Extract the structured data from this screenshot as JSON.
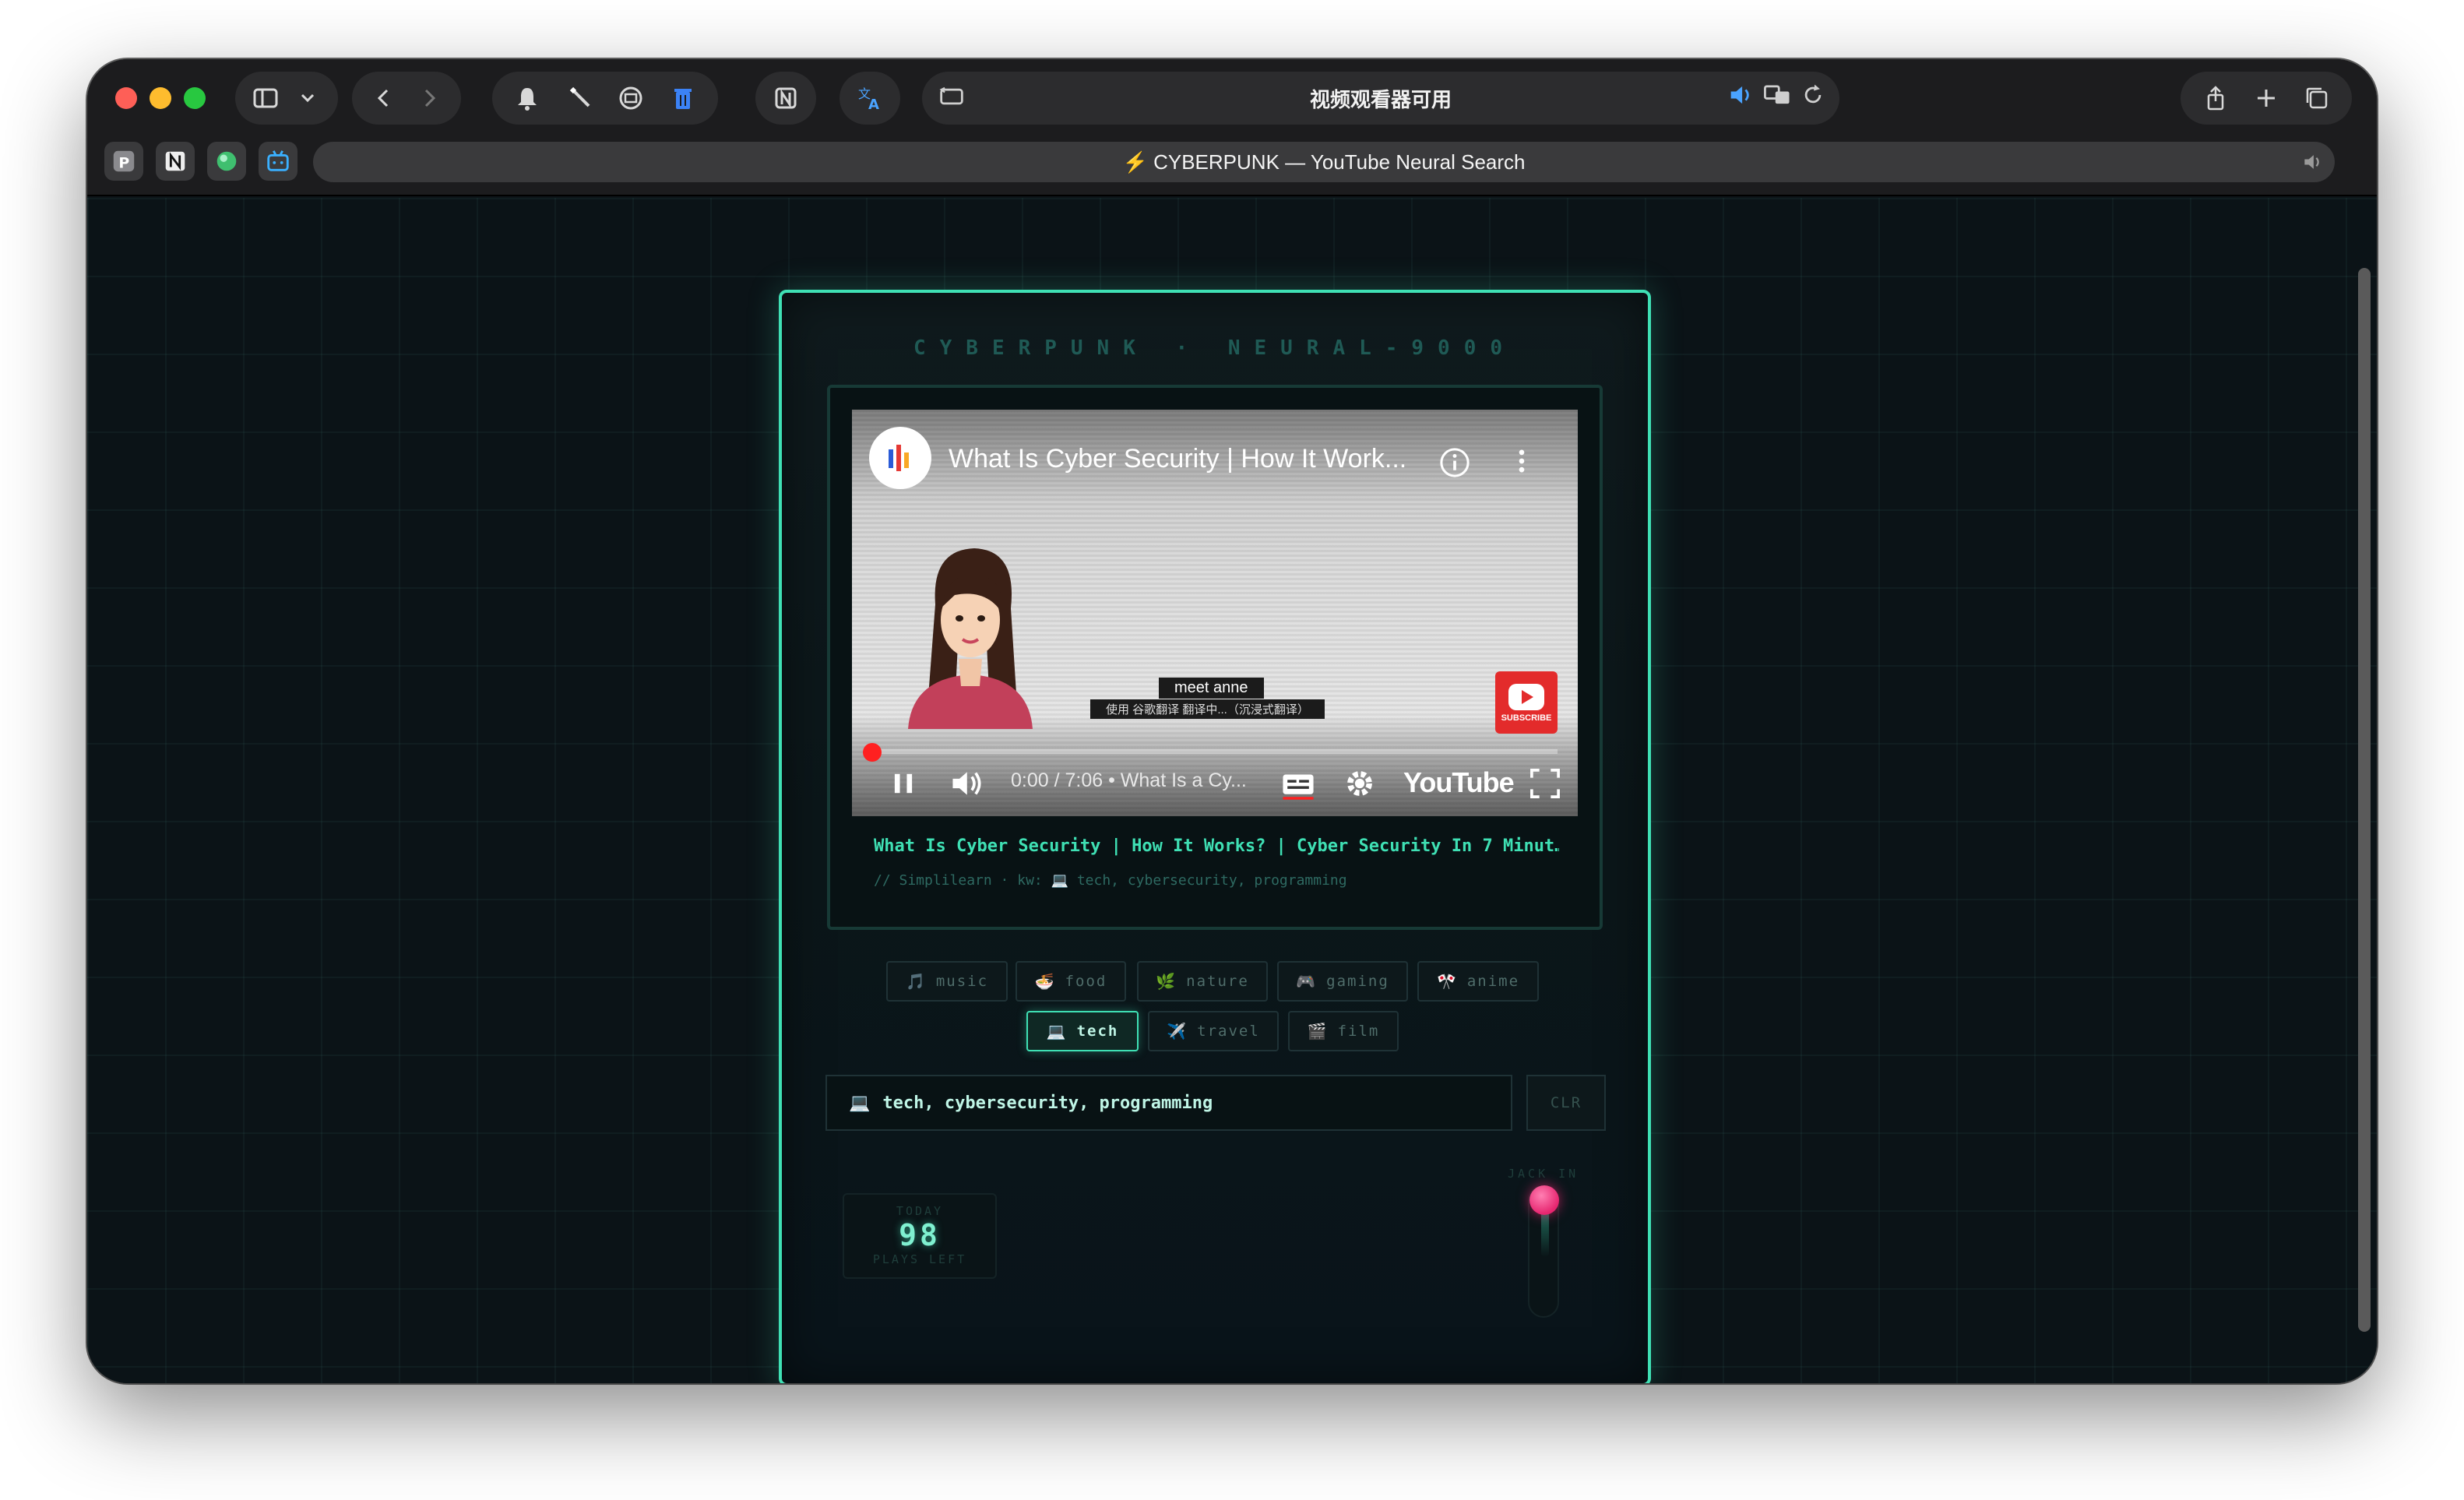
{
  "browser": {
    "address_title": "视频观看器可用",
    "tab_title": "⚡ CYBERPUNK — YouTube Neural Search"
  },
  "card": {
    "header": "CYBERPUNK · NEURAL-9000"
  },
  "video": {
    "title": "What Is Cyber Security | How It Work...",
    "caption_line1": "meet anne",
    "caption_line2": "使用 谷歌翻译 翻译中...（沉浸式翻译）",
    "subscribe_label": "SUBSCRIBE",
    "time_text": "0:00 / 7:06 • What Is a Cy...",
    "brand_word": "YouTube",
    "progress_fraction": 0.0
  },
  "info": {
    "title": "What Is Cyber Security | How It Works? | Cyber Security In 7 Minut…",
    "meta": "// Simplilearn · kw: 💻 tech, cybersecurity, programming"
  },
  "chips": [
    {
      "icon": "🎵",
      "label": "music",
      "active": false
    },
    {
      "icon": "🍜",
      "label": "food",
      "active": false
    },
    {
      "icon": "🌿",
      "label": "nature",
      "active": false
    },
    {
      "icon": "🎮",
      "label": "gaming",
      "active": false
    },
    {
      "icon": "🎌",
      "label": "anime",
      "active": false
    },
    {
      "icon": "💻",
      "label": "tech",
      "active": true
    },
    {
      "icon": "✈️",
      "label": "travel",
      "active": false
    },
    {
      "icon": "🎬",
      "label": "film",
      "active": false
    }
  ],
  "search": {
    "icon": "💻",
    "value": "tech, cybersecurity, programming",
    "clear_label": "CLR"
  },
  "counter": {
    "top_label": "TODAY",
    "value": "98",
    "bottom_label": "PLAYS LEFT"
  },
  "jack": {
    "label": "JACK IN"
  },
  "colors": {
    "accent": "#3fe0b4",
    "knob": "#e6256f",
    "progress": "#ff2020"
  }
}
